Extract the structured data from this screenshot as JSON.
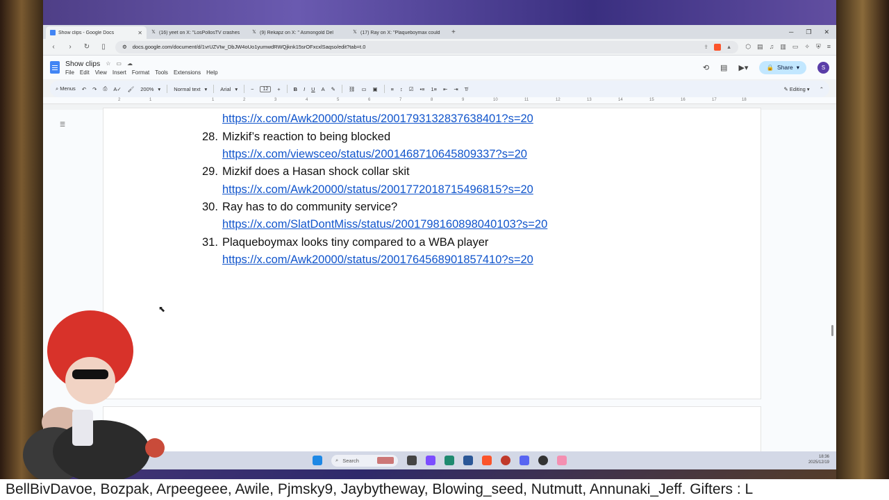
{
  "browser": {
    "tabs": [
      {
        "title": "Show clips - Google Docs",
        "icon": "docs-icon",
        "active": true
      },
      {
        "title": "(16) yeet on X: \"LosPollosTV crashes",
        "icon": "x-icon"
      },
      {
        "title": "(9) Rekapz on X: \" Asmongold Del",
        "icon": "x-icon"
      },
      {
        "title": "(17) Ray on X: \"Plaqueboymax could",
        "icon": "x-icon"
      }
    ],
    "url": "docs.google.com/document/d/1vrUZVIw_DbJW4oUo1yumwdRWQjknk15srOFxcxlSaqso/edit?tab=t.0"
  },
  "docs": {
    "title": "Show clips",
    "menus": [
      "File",
      "Edit",
      "View",
      "Insert",
      "Format",
      "Tools",
      "Extensions",
      "Help"
    ],
    "share_label": "Share",
    "avatar_letter": "S",
    "toolbar": {
      "menus_label": "Menus",
      "zoom": "200%",
      "style": "Normal text",
      "font": "Arial",
      "font_size": "12",
      "mode": "Editing"
    },
    "ruler": [
      "2",
      "1",
      "1",
      "2",
      "3",
      "4",
      "5",
      "6",
      "7",
      "8",
      "9",
      "10",
      "11",
      "12",
      "13",
      "14",
      "15",
      "16",
      "17",
      "18"
    ]
  },
  "document": {
    "first_link": "https://x.com/Awk20000/status/2001793132837638401?s=20",
    "items": [
      {
        "num": "28.",
        "text": "Mizkif’s reaction to being blocked",
        "link": "https://x.com/viewsceo/status/2001468710645809337?s=20"
      },
      {
        "num": "29.",
        "text": "Mizkif does a Hasan shock collar skit",
        "link": "https://x.com/Awk20000/status/2001772018715496815?s=20"
      },
      {
        "num": "30.",
        "text": "Ray has to do community service?",
        "link": "https://x.com/SlatDontMiss/status/2001798160898040103?s=20"
      },
      {
        "num": "31.",
        "text": "Plaqueboymax looks tiny compared to a WBA player",
        "link": "https://x.com/Awk20000/status/2001764568901857410?s=20"
      }
    ]
  },
  "taskbar": {
    "search_label": "Search",
    "time": "18:36",
    "date": "2025/12/19"
  },
  "ticker": "BellBivDavoe, Bozpak, Arpeegeee, Awile, Pjmsky9, Jaybytheway, Blowing_seed, Nutmutt, Annunaki_Jeff. Gifters : L"
}
